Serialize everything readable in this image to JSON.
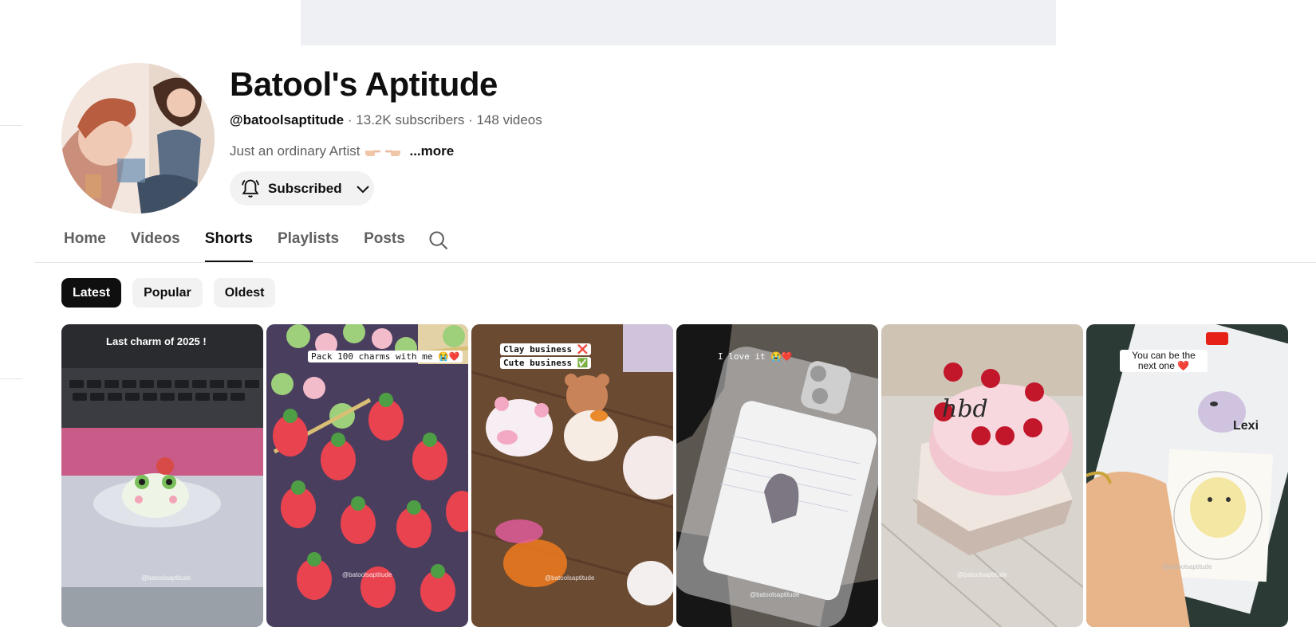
{
  "channel": {
    "name": "Batool's Aptitude",
    "handle": "@batoolsaptitude",
    "subscribers": "13.2K subscribers",
    "videos": "148 videos",
    "separator": "·",
    "description": "Just an ordinary Artist",
    "more_label": "...more"
  },
  "subscribe_button": {
    "label": "Subscribed",
    "icon": "bell-icon",
    "dropdown_icon": "chevron-down-icon"
  },
  "tabs": [
    {
      "label": "Home"
    },
    {
      "label": "Videos"
    },
    {
      "label": "Shorts",
      "active": true
    },
    {
      "label": "Playlists"
    },
    {
      "label": "Posts"
    }
  ],
  "search_icon": "search-icon",
  "filter_chips": [
    {
      "label": "Latest",
      "selected": true
    },
    {
      "label": "Popular"
    },
    {
      "label": "Oldest"
    }
  ],
  "shorts": [
    {
      "caption": "Last charm of 2025 !",
      "watermark": "@batoolsaptitude"
    },
    {
      "caption": "Pack 100 charms with me 😭❤️",
      "watermark": "@batoolsaptitude"
    },
    {
      "caption_lines": [
        "Clay business ❌",
        "Cute business ✅"
      ],
      "watermark": "@batoolsaptitude"
    },
    {
      "caption": "I love it 😭❤️",
      "watermark": "@batoolsaptitude"
    },
    {
      "caption": "",
      "overlay_text": "hbd",
      "watermark": "@batoolsaptitude"
    },
    {
      "caption": "You can be the next one ❤️",
      "overlay_text": "Lexi",
      "watermark": "@batoolsaptitude"
    }
  ],
  "colors": {
    "text_primary": "#0f0f0f",
    "text_secondary": "#606060",
    "chip_bg": "#f2f2f2",
    "chip_selected_bg": "#0f0f0f"
  }
}
